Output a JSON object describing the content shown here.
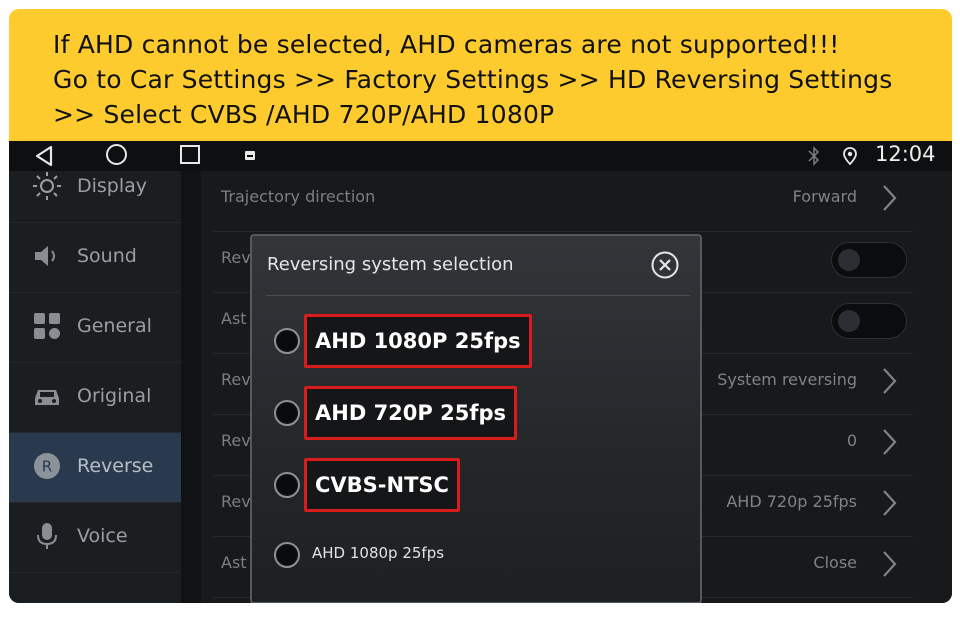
{
  "banner": {
    "line1": "If AHD cannot be selected, AHD cameras are not supported!!!",
    "line2": "Go to Car Settings >> Factory Settings >> HD Reversing Settings",
    "line3": ">> Select CVBS /AHD 720P/AHD 1080P",
    "background_color": "#fdcb2e"
  },
  "statusbar": {
    "time": "12:04",
    "icons": [
      "back-icon",
      "home-icon",
      "recents-icon",
      "notification-icon",
      "bluetooth-icon",
      "location-icon"
    ]
  },
  "sidebar": {
    "items": [
      {
        "label": "Display",
        "icon": "sun-icon",
        "active": false
      },
      {
        "label": "Sound",
        "icon": "speaker-icon",
        "active": false
      },
      {
        "label": "General",
        "icon": "grid-icon",
        "active": false
      },
      {
        "label": "Original",
        "icon": "car-icon",
        "active": false
      },
      {
        "label": "Reverse",
        "icon": "reverse-r-icon",
        "active": true
      },
      {
        "label": "Voice",
        "icon": "microphone-icon",
        "active": false
      }
    ],
    "active_color": "#2a3a4e"
  },
  "list": {
    "rows": [
      {
        "label": "Trajectory direction",
        "value": "Forward",
        "control": "chevron"
      },
      {
        "label": "Rev",
        "value": "",
        "control": "toggle"
      },
      {
        "label": "Ast",
        "value": "",
        "control": "toggle"
      },
      {
        "label": "Rev",
        "value": "System reversing",
        "control": "chevron"
      },
      {
        "label": "Rev",
        "value": "0",
        "control": "chevron"
      },
      {
        "label": "Rev",
        "value": "AHD 720p 25fps",
        "control": "chevron"
      },
      {
        "label": "Ast",
        "value": "Close",
        "control": "chevron"
      }
    ]
  },
  "modal": {
    "title": "Reversing system selection",
    "options": [
      {
        "label": "AHD 1080P 25fps",
        "highlighted": true
      },
      {
        "label": "AHD 720P 25fps",
        "highlighted": true
      },
      {
        "label": "CVBS-NTSC",
        "highlighted": true
      },
      {
        "label": "AHD 1080p 25fps",
        "highlighted": false
      }
    ],
    "highlight_color": "#d81c1c"
  }
}
